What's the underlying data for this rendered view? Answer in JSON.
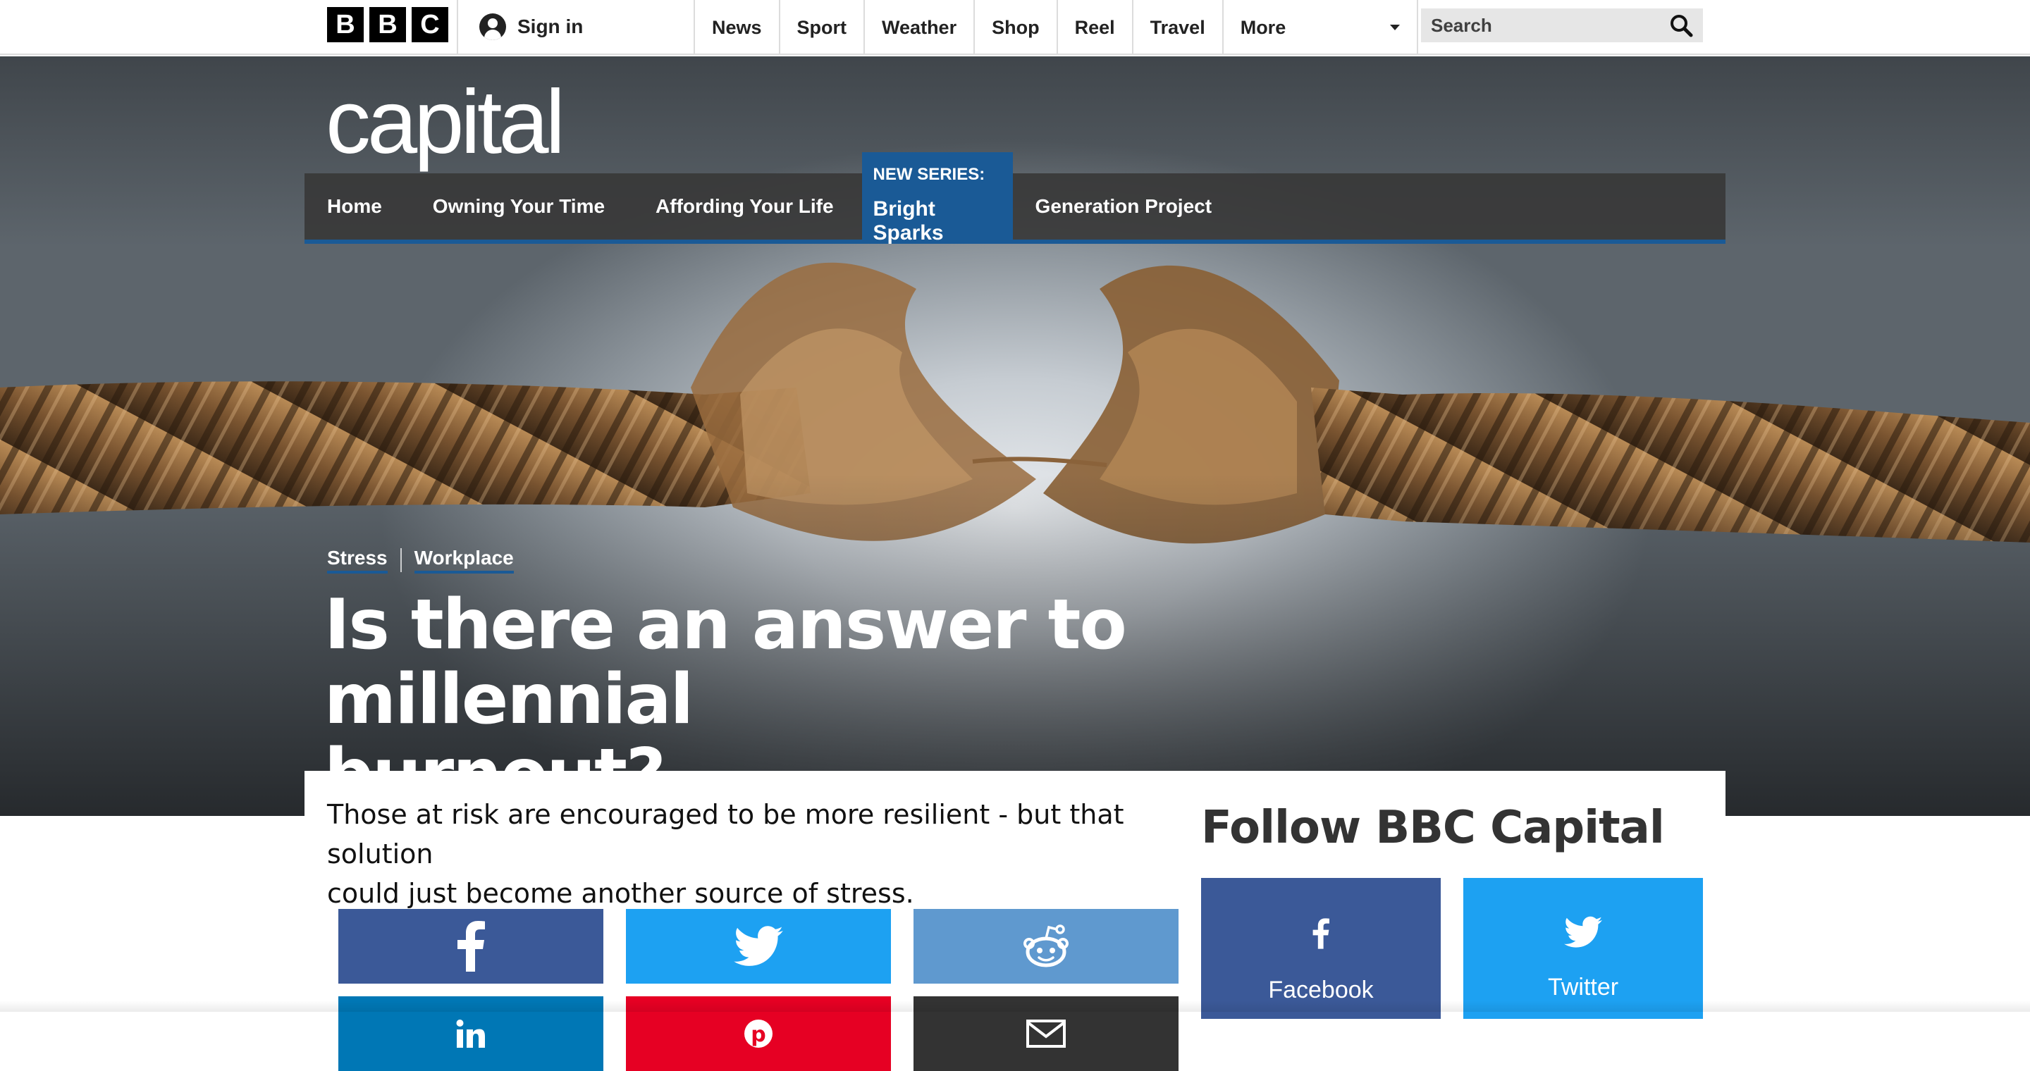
{
  "topbar": {
    "logo_letters": [
      "B",
      "B",
      "C"
    ],
    "sign_in_label": "Sign in",
    "nav": [
      "News",
      "Sport",
      "Weather",
      "Shop",
      "Reel",
      "Travel"
    ],
    "more_label": "More",
    "search_placeholder": "Search"
  },
  "brand": {
    "name": "capital"
  },
  "section_nav": {
    "items_before": [
      "Home",
      "Owning Your Time",
      "Affording Your Life"
    ],
    "series_kicker": "NEW SERIES:",
    "series_title": "Bright Sparks",
    "items_after": [
      "Generation Project"
    ],
    "active_color": "#1a5a96"
  },
  "article": {
    "tags": [
      "Stress",
      "Workplace"
    ],
    "headline_line1": "Is there an answer to millennial",
    "headline_line2": "burnout?",
    "summary_line1": "Those at risk are encouraged to be more resilient - but that solution",
    "summary_line2": "could just become another source of stress."
  },
  "share": {
    "buttons": [
      {
        "name": "facebook",
        "icon": "facebook-icon",
        "color": "#3b5998"
      },
      {
        "name": "twitter",
        "icon": "twitter-icon",
        "color": "#1da1f2"
      },
      {
        "name": "reddit",
        "icon": "reddit-icon",
        "color": "#5f99cf"
      },
      {
        "name": "linkedin",
        "icon": "linkedin-icon",
        "color": "#0077b5"
      },
      {
        "name": "pinterest",
        "icon": "pinterest-icon",
        "color": "#e60023"
      },
      {
        "name": "email",
        "icon": "email-icon",
        "color": "#333333"
      }
    ]
  },
  "follow": {
    "title": "Follow BBC Capital",
    "cards": [
      {
        "label": "Facebook",
        "icon": "facebook-icon",
        "color": "#3b5998"
      },
      {
        "label": "Twitter",
        "icon": "twitter-icon",
        "color": "#1da1f2"
      }
    ]
  }
}
